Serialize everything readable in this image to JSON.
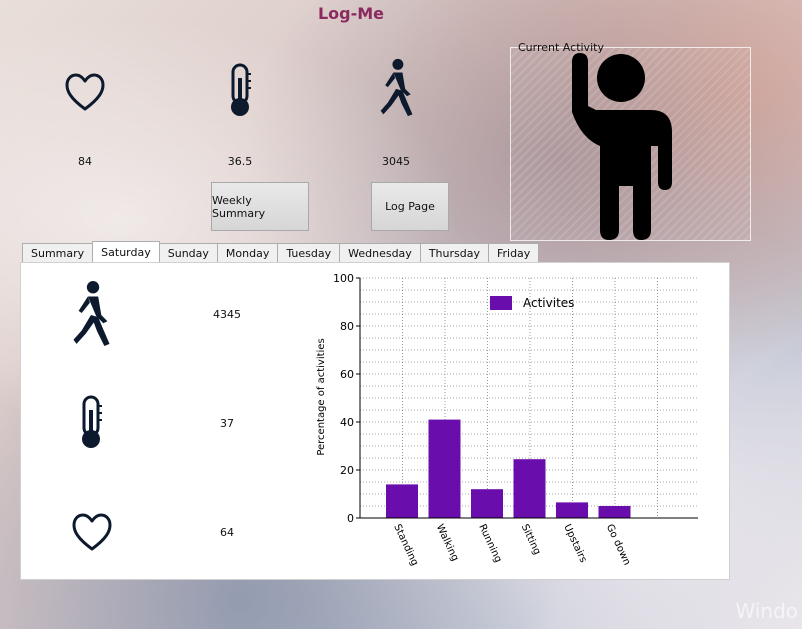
{
  "app": {
    "title": "Log-Me"
  },
  "top": {
    "heart_rate": "84",
    "temperature": "36.5",
    "steps": "3045"
  },
  "buttons": {
    "weekly_summary": "Weekly Summary",
    "log_page": "Log Page"
  },
  "current_activity": {
    "title": "Current Activity",
    "icon": "person-waving-icon"
  },
  "tabs": [
    {
      "label": "Summary"
    },
    {
      "label": "Saturday",
      "active": true
    },
    {
      "label": "Sunday"
    },
    {
      "label": "Monday"
    },
    {
      "label": "Tuesday"
    },
    {
      "label": "Wednesday"
    },
    {
      "label": "Thursday"
    },
    {
      "label": "Friday"
    }
  ],
  "day_panel": {
    "steps": "4345",
    "temperature": "37",
    "heart_rate": "64"
  },
  "chart_data": {
    "type": "bar",
    "categories": [
      "Standing",
      "Walking",
      "Running",
      "Sitting",
      "Upstairs",
      "Go down"
    ],
    "series": [
      {
        "name": "Activites",
        "values": [
          14,
          41,
          12,
          24.5,
          6.5,
          5
        ]
      }
    ],
    "ylabel": "Percentage of activities",
    "ylim": [
      0,
      100
    ],
    "yticks": [
      0,
      20,
      40,
      60,
      80,
      100
    ],
    "grid": true,
    "legend_position": "top",
    "bar_color": "#6a0dad"
  },
  "watermark": "Windo"
}
